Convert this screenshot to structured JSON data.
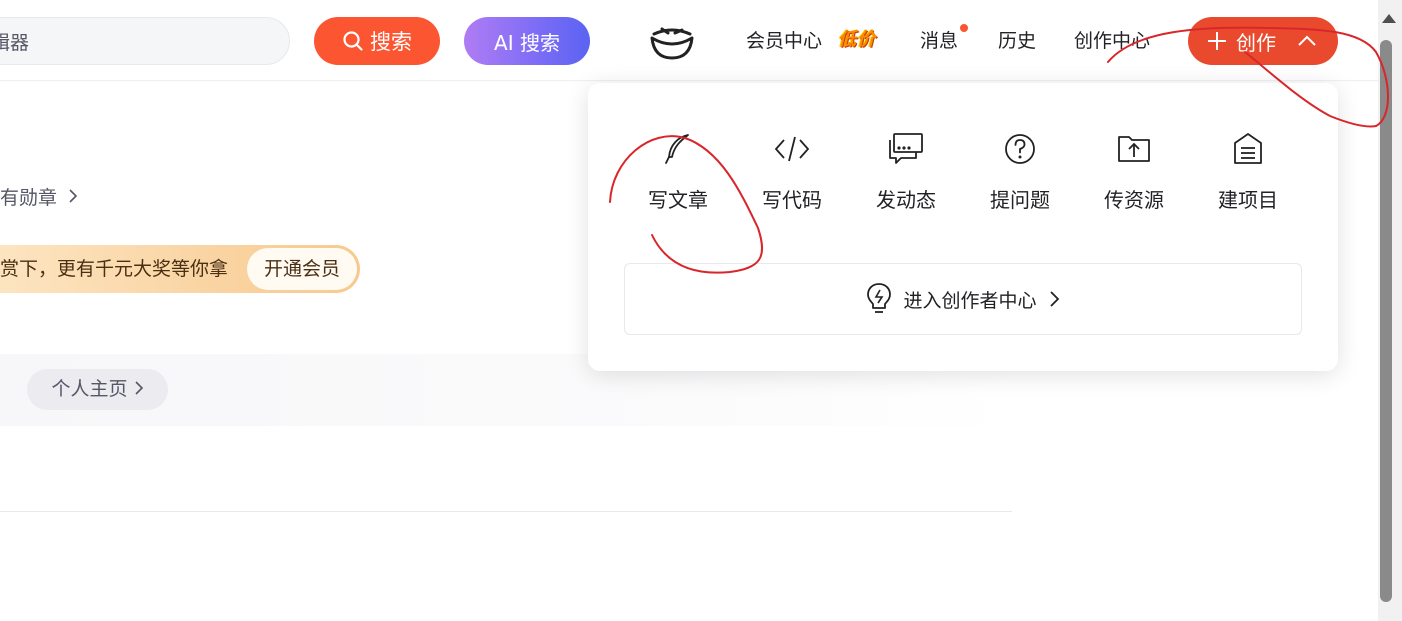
{
  "header": {
    "search": {
      "value": "辑器"
    },
    "search_button_label": "搜索",
    "ai_button_label": "AI 搜索",
    "nav": {
      "vip_center": "会员中心",
      "vip_badge": "低价",
      "messages": "消息",
      "history": "历史",
      "creation_center": "创作中心"
    },
    "create_button_label": "创作"
  },
  "main": {
    "medal_link": "有勋章",
    "vip_banner_text": "赏下，更有千元大奖等你拿",
    "vip_button": "开通会员",
    "profile_button": "个人主页"
  },
  "dropdown": {
    "items": [
      {
        "label": "写文章",
        "icon": "feather-pen-icon"
      },
      {
        "label": "写代码",
        "icon": "code-brackets-icon"
      },
      {
        "label": "发动态",
        "icon": "chat-bubble-icon"
      },
      {
        "label": "提问题",
        "icon": "question-circle-icon"
      },
      {
        "label": "传资源",
        "icon": "upload-folder-icon"
      },
      {
        "label": "建项目",
        "icon": "house-document-icon"
      }
    ],
    "creator_center_label": "进入创作者中心"
  },
  "colors": {
    "brand_red": "#fc5531",
    "create_button": "#e94a2e",
    "ai_gradient_start": "#b07cf3",
    "ai_gradient_end": "#5b63f2",
    "annotation_red": "#d9262b"
  }
}
